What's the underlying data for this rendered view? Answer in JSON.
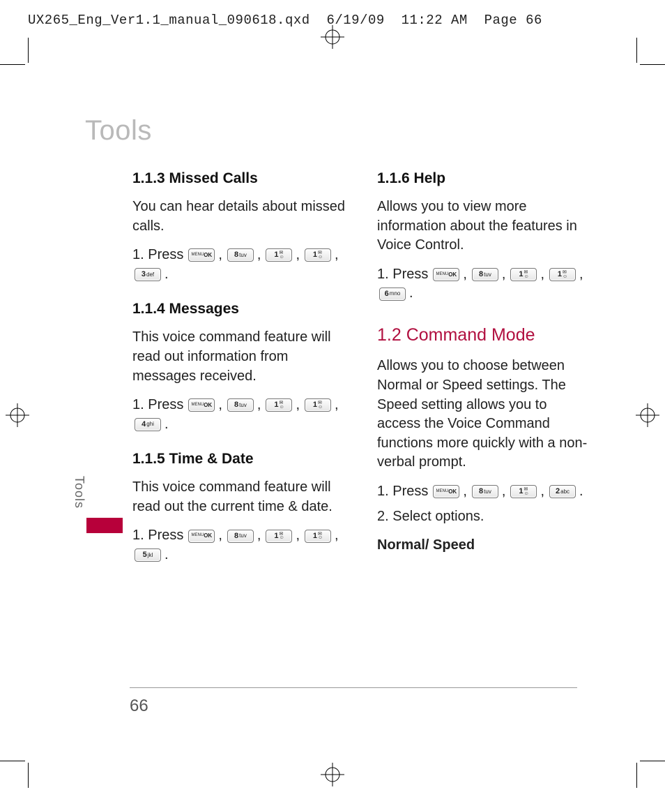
{
  "slug": "UX265_Eng_Ver1.1_manual_090618.qxd  6/19/09  11:22 AM  Page 66",
  "chapter_title": "Tools",
  "side_tab": "Tools",
  "page_number": "66",
  "keys": {
    "ok_top": "MENU",
    "ok_bot": "OK",
    "k1_num": "1",
    "k1_lbl": "",
    "k2_num": "2",
    "k2_lbl": "abc",
    "k3_num": "3",
    "k3_lbl": "def",
    "k4_num": "4",
    "k4_lbl": "ghi",
    "k5_num": "5",
    "k5_lbl": "jkl",
    "k6_num": "6",
    "k6_lbl": "mno",
    "k8_num": "8",
    "k8_lbl": "tuv"
  },
  "left": {
    "s113": {
      "title": "1.1.3 Missed Calls",
      "body": "You can hear details about missed calls.",
      "press": "1. Press"
    },
    "s114": {
      "title": "1.1.4 Messages",
      "body": "This voice command feature will read out information from messages received.",
      "press": "1. Press"
    },
    "s115": {
      "title": "1.1.5 Time & Date",
      "body": "This voice command feature will read out the current time & date.",
      "press": "1. Press"
    }
  },
  "right": {
    "s116": {
      "title": "1.1.6 Help",
      "body": "Allows you to view more information about the features in Voice Control.",
      "press": "1. Press"
    },
    "s12": {
      "title": "1.2 Command Mode",
      "body": "Allows you to choose between Normal or Speed settings. The Speed setting allows you to access the Voice Command functions more quickly with a non-verbal prompt.",
      "press": "1. Press",
      "step2": "2. Select options.",
      "opts": "Normal/ Speed"
    }
  }
}
